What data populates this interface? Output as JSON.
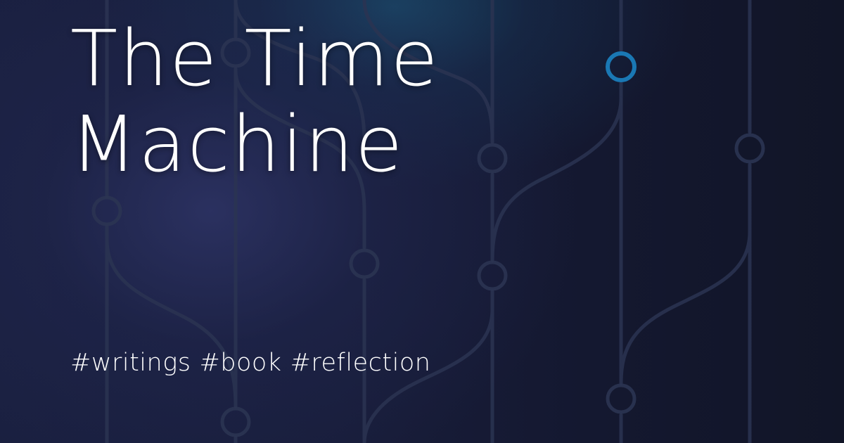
{
  "card": {
    "title_line_1": "The Time",
    "title_line_2": "Machine",
    "tags": [
      "#writings",
      "#book",
      "#reflection"
    ]
  },
  "colors": {
    "background": "#121627",
    "text": "#ffffff",
    "graph_lines": "#2c3552",
    "highlight_node": "#1a78b4"
  },
  "icons": {
    "background_pattern": "git-branch-graph"
  }
}
